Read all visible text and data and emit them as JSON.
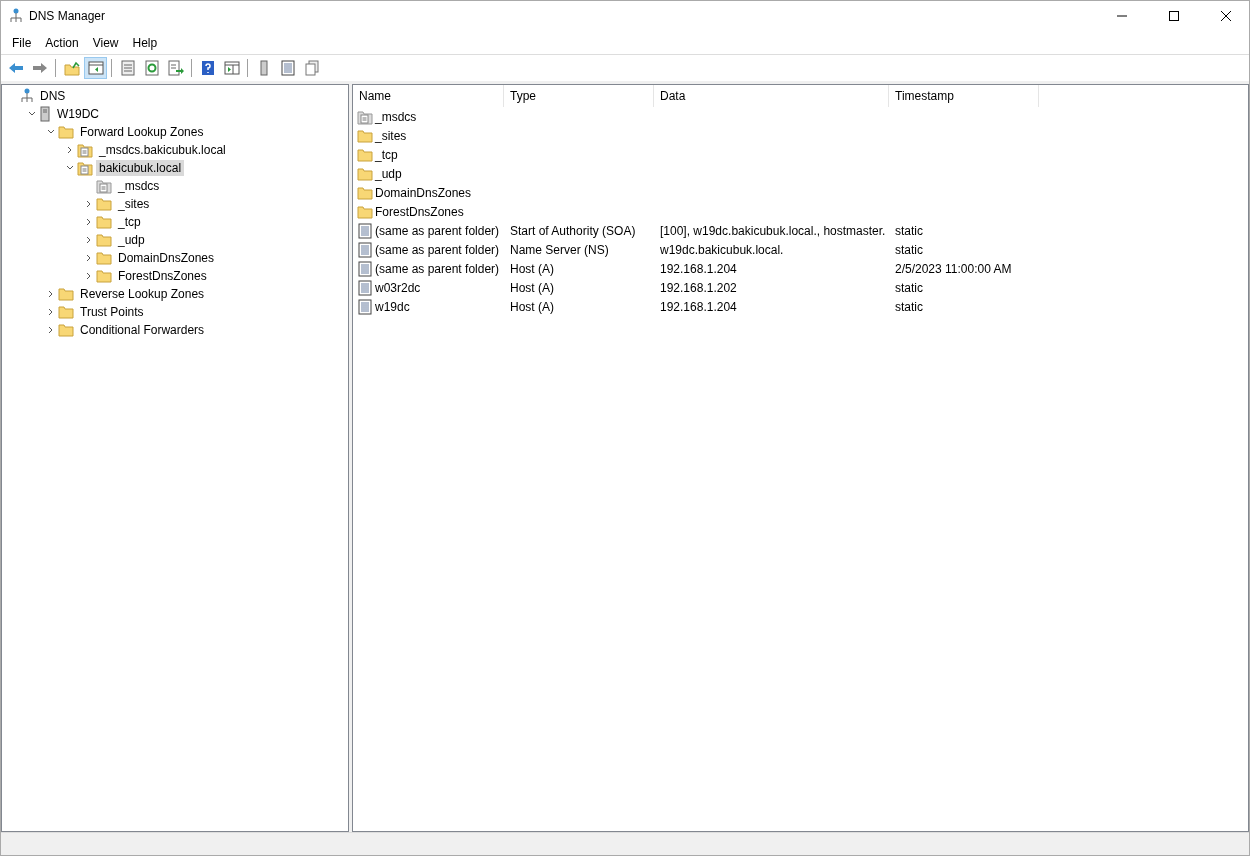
{
  "window": {
    "title": "DNS Manager",
    "controls": [
      {
        "kind": "minimize"
      },
      {
        "kind": "maximize"
      },
      {
        "kind": "close"
      }
    ]
  },
  "menu": [
    "File",
    "Action",
    "View",
    "Help"
  ],
  "toolbar": [
    {
      "kind": "back",
      "pressed": false
    },
    {
      "kind": "forward",
      "pressed": false
    },
    {
      "kind": "sep"
    },
    {
      "kind": "up",
      "pressed": false
    },
    {
      "kind": "tree",
      "pressed": true
    },
    {
      "kind": "sep"
    },
    {
      "kind": "properties",
      "pressed": false
    },
    {
      "kind": "refresh",
      "pressed": false
    },
    {
      "kind": "export",
      "pressed": false
    },
    {
      "kind": "sep"
    },
    {
      "kind": "help",
      "pressed": false
    },
    {
      "kind": "pane",
      "pressed": false
    },
    {
      "kind": "sep"
    },
    {
      "kind": "server",
      "pressed": false
    },
    {
      "kind": "list",
      "pressed": false
    },
    {
      "kind": "copy",
      "pressed": false
    }
  ],
  "tree": [
    {
      "label": "DNS",
      "kind": "network",
      "selected": false,
      "children": [
        {
          "label": "W19DC",
          "kind": "server",
          "expanded": true,
          "selected": false,
          "children": [
            {
              "label": "Forward Lookup Zones",
              "kind": "folder",
              "expanded": true,
              "selected": false,
              "children": [
                {
                  "label": "_msdcs.bakicubuk.local",
                  "kind": "zone",
                  "expanded": false,
                  "selected": false
                },
                {
                  "label": "bakicubuk.local",
                  "kind": "zone",
                  "expanded": true,
                  "selected": true,
                  "children": [
                    {
                      "label": "_msdcs",
                      "kind": "delegation",
                      "selected": false
                    },
                    {
                      "label": "_sites",
                      "kind": "folder",
                      "expanded": false,
                      "selected": false
                    },
                    {
                      "label": "_tcp",
                      "kind": "folder",
                      "expanded": false,
                      "selected": false
                    },
                    {
                      "label": "_udp",
                      "kind": "folder",
                      "expanded": false,
                      "selected": false
                    },
                    {
                      "label": "DomainDnsZones",
                      "kind": "folder",
                      "expanded": false,
                      "selected": false
                    },
                    {
                      "label": "ForestDnsZones",
                      "kind": "folder",
                      "expanded": false,
                      "selected": false
                    }
                  ]
                }
              ]
            },
            {
              "label": "Reverse Lookup Zones",
              "kind": "folder",
              "expanded": false,
              "selected": false
            },
            {
              "label": "Trust Points",
              "kind": "folder",
              "expanded": false,
              "selected": false
            },
            {
              "label": "Conditional Forwarders",
              "kind": "folder",
              "expanded": false,
              "selected": false
            }
          ]
        }
      ]
    }
  ],
  "table": {
    "columns": [
      "Name",
      "Type",
      "Data",
      "Timestamp"
    ],
    "rows": [
      {
        "kind": "delegation",
        "name": "_msdcs"
      },
      {
        "kind": "folder",
        "name": "_sites"
      },
      {
        "kind": "folder",
        "name": "_tcp"
      },
      {
        "kind": "folder",
        "name": "_udp"
      },
      {
        "kind": "folder",
        "name": "DomainDnsZones"
      },
      {
        "kind": "folder",
        "name": "ForestDnsZones"
      },
      {
        "kind": "record",
        "name": "(same as parent folder)",
        "type": "Start of Authority (SOA)",
        "data": "[100], w19dc.bakicubuk.local., hostmaster.",
        "timestamp": "static"
      },
      {
        "kind": "record",
        "name": "(same as parent folder)",
        "type": "Name Server (NS)",
        "data": "w19dc.bakicubuk.local.",
        "timestamp": "static"
      },
      {
        "kind": "record",
        "name": "(same as parent folder)",
        "type": "Host (A)",
        "data": "192.168.1.204",
        "timestamp": "2/5/2023 11:00:00 AM"
      },
      {
        "kind": "record",
        "name": "w03r2dc",
        "type": "Host (A)",
        "data": "192.168.1.202",
        "timestamp": "static"
      },
      {
        "kind": "record",
        "name": "w19dc",
        "type": "Host (A)",
        "data": "192.168.1.204",
        "timestamp": "static"
      }
    ]
  }
}
